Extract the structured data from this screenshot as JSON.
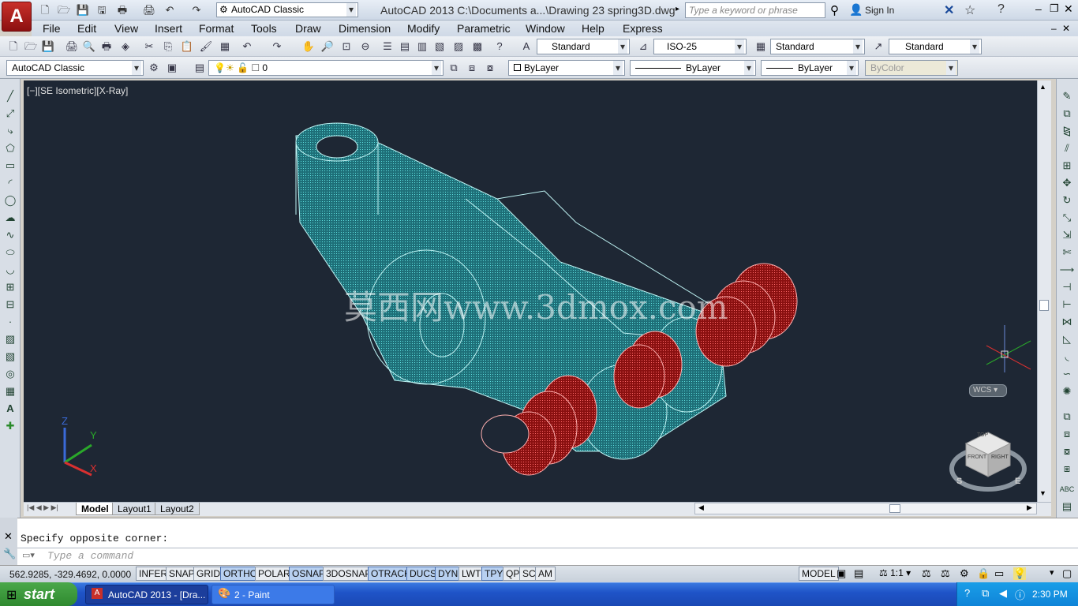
{
  "app": {
    "workspace": "AutoCAD Classic",
    "window_title": "AutoCAD 2013    C:\\Documents a...\\Drawing 23 spring3D.dwg",
    "search_placeholder": "Type a keyword or phrase",
    "sign_in": "Sign In"
  },
  "menus": [
    "File",
    "Edit",
    "View",
    "Insert",
    "Format",
    "Tools",
    "Draw",
    "Dimension",
    "Modify",
    "Parametric",
    "Window",
    "Help",
    "Express"
  ],
  "toolbar1": {
    "text_style": "Standard",
    "dim_style": "ISO-25",
    "table_style": "Standard",
    "multileader_style": "Standard"
  },
  "toolbar2": {
    "workspace": "AutoCAD Classic",
    "layer": "0",
    "color": "ByLayer",
    "linetype": "ByLayer",
    "lineweight": "ByLayer",
    "plot_style": "ByColor"
  },
  "viewport": {
    "label": "[−][SE Isometric][X-Ray]",
    "watermark": "莫西网www.3dmox.com",
    "wcs": "WCS",
    "ucs": {
      "x": "X",
      "y": "Y",
      "z": "Z"
    },
    "viewcube": {
      "top": "TOP",
      "front": "FRONT",
      "right": "RIGHT",
      "south": "S",
      "east": "E"
    }
  },
  "tabs": {
    "model": "Model",
    "layout1": "Layout1",
    "layout2": "Layout2"
  },
  "command": {
    "history": "Specify opposite corner:",
    "placeholder": "Type a command"
  },
  "status": {
    "coords": "562.9285, -329.4692, 0.0000",
    "toggles": [
      {
        "label": "INFER",
        "on": false
      },
      {
        "label": "SNAP",
        "on": false
      },
      {
        "label": "GRID",
        "on": false
      },
      {
        "label": "ORTHO",
        "on": true
      },
      {
        "label": "POLAR",
        "on": false
      },
      {
        "label": "OSNAP",
        "on": true
      },
      {
        "label": "3DOSNAP",
        "on": false
      },
      {
        "label": "OTRACK",
        "on": true
      },
      {
        "label": "DUCS",
        "on": true
      },
      {
        "label": "DYN",
        "on": true
      },
      {
        "label": "LWT",
        "on": false
      },
      {
        "label": "TPY",
        "on": true
      },
      {
        "label": "QP",
        "on": false
      },
      {
        "label": "SC",
        "on": false
      },
      {
        "label": "AM",
        "on": false
      }
    ],
    "model": "MODEL",
    "scale": "1:1"
  },
  "taskbar": {
    "start": "start",
    "tasks": [
      "AutoCAD 2013 - [Dra...",
      "2 - Paint"
    ],
    "clock": "2:30 PM"
  },
  "colors": {
    "viewport_bg": "#1e2734",
    "part": "#2ab8b8",
    "spring": "#c01818",
    "taskbar": "#1f54c8"
  }
}
